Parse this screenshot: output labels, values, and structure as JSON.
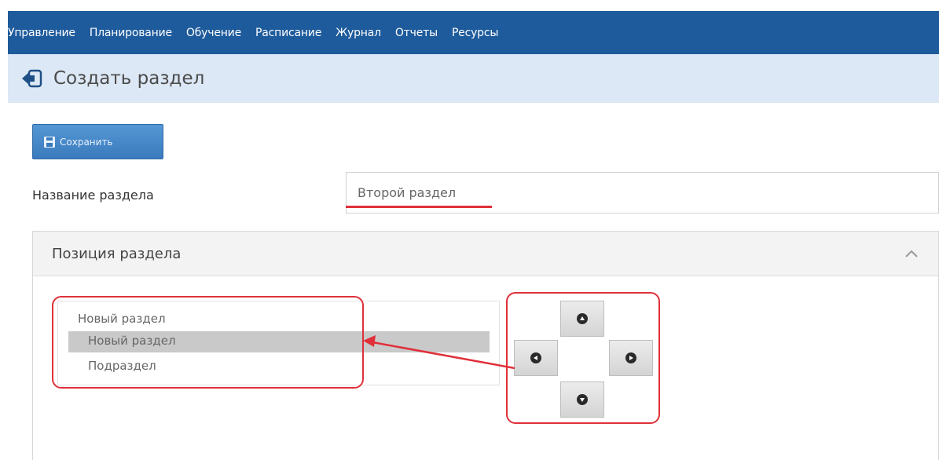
{
  "nav": {
    "items": [
      "Управление",
      "Планирование",
      "Обучение",
      "Расписание",
      "Журнал",
      "Отчеты",
      "Ресурсы"
    ]
  },
  "header": {
    "back_icon": "back-arrow-icon",
    "title": "Создать раздел"
  },
  "toolbar": {
    "save_label": "Сохранить",
    "save_icon": "save-icon"
  },
  "form": {
    "name_label": "Название раздела",
    "name_value": "Второй раздел"
  },
  "position_panel": {
    "title": "Позиция раздела",
    "collapse_icon": "chevron-up-icon",
    "tree": {
      "items": [
        {
          "label": "Новый раздел",
          "level": 0,
          "selected": false
        },
        {
          "label": "Новый раздел",
          "level": 1,
          "selected": true
        },
        {
          "label": "Подраздел",
          "level": 1,
          "selected": false
        }
      ]
    },
    "move_buttons": {
      "up": "arrow-up-icon",
      "left": "arrow-left-icon",
      "right": "arrow-right-icon",
      "down": "arrow-down-icon"
    }
  },
  "colors": {
    "nav_bg": "#1e5b9c",
    "header_bg": "#dce8f5",
    "save_button": "#3a7bbd",
    "annotation": "#e0303a",
    "selected_row": "#c9c9c9"
  }
}
